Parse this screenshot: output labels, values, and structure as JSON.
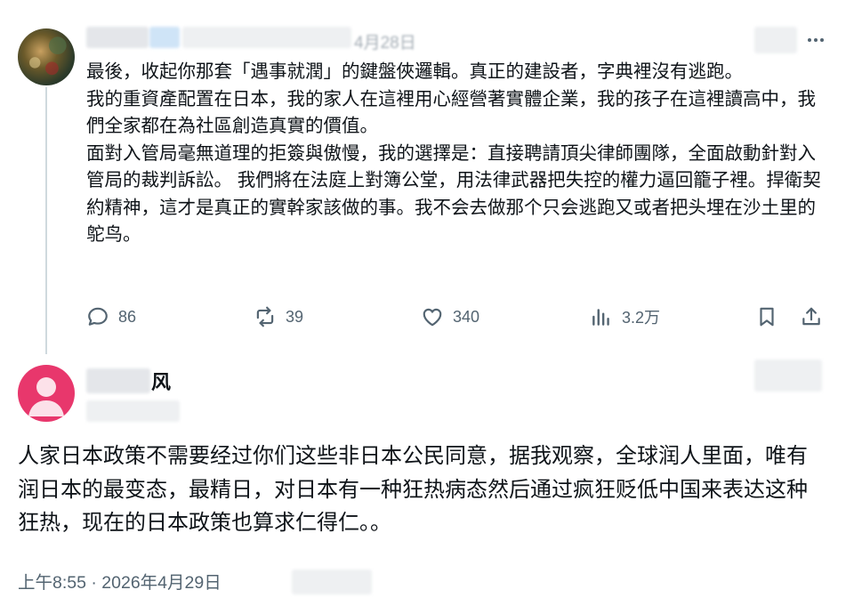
{
  "post": {
    "date_fragment": "4月28日",
    "paragraphs": [
      "最後，收起你那套「遇事就潤」的鍵盤俠邏輯。真正的建設者，字典裡沒有逃跑。",
      "我的重資產配置在日本，我的家人在這裡用心經營著實體企業，我的孩子在這裡讀高中，我們全家都在為社區創造真實的價值。",
      "面對入管局毫無道理的拒簽與傲慢，我的選擇是：直接聘請頂尖律師團隊，全面啟動針對入管局的裁判訴訟。 我們將在法庭上對簿公堂，用法律武器把失控的權力逼回籠子裡。捍衛契約精神，這才是真正的實幹家該做的事。我不会去做那个只会逃跑又或者把头埋在沙土里的鸵鸟。"
    ],
    "stats": {
      "replies": "86",
      "reposts": "39",
      "likes": "340",
      "views": "3.2万"
    }
  },
  "reply": {
    "name_partial": "风",
    "text": "人家日本政策不需要经过你们这些非日本公民同意，据我观察，全球润人里面，唯有润日本的最变态，最精日，对日本有一种狂热病态然后通过疯狂贬低中国来表达这种狂热，现在的日本政策也算求仁得仁。。",
    "timestamp": "上午8:55 · 2026年4月29日"
  },
  "colors": {
    "text": "#0f1419",
    "secondary": "#536471",
    "thread_line": "#cfd9de",
    "reply_avatar": "#e8376c"
  }
}
